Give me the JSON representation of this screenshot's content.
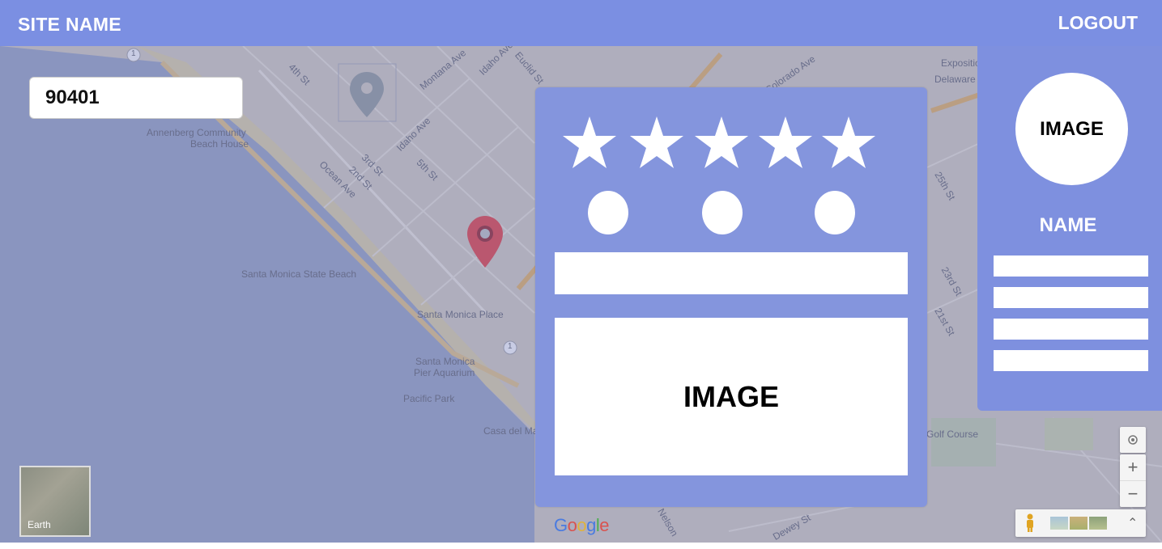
{
  "header": {
    "site_name": "SITE NAME",
    "logout_label": "LOGOUT"
  },
  "search": {
    "zip_value": "90401"
  },
  "map": {
    "labels": [
      "4th St",
      "Montana Ave",
      "Idaho Ave",
      "Euclid St",
      "Idaho Ave",
      "5th St",
      "3rd St",
      "2nd St",
      "Ocean Ave",
      "Annenberg Community",
      "Beach House",
      "Santa Monica State Beach",
      "Santa Monica Place",
      "Santa Monica",
      "Pier Aquarium",
      "Pacific Park",
      "Casa del Mar",
      "Colorado Ave",
      "Expositio",
      "Delaware Ave",
      "25th St",
      "23rd St",
      "21st St",
      "Golf Course",
      "Dewey St",
      "Nelson"
    ],
    "route_badge": "1",
    "earth_label": "Earth",
    "attribution": [
      "G",
      "o",
      "o",
      "g",
      "l",
      "e"
    ]
  },
  "review_card": {
    "rating_max": 5,
    "rating_value": 5,
    "option_count": 3,
    "image_label": "IMAGE"
  },
  "profile": {
    "avatar_label": "IMAGE",
    "name": "NAME",
    "field_count": 4
  },
  "controls": {
    "zoom_in": "+",
    "zoom_out": "−",
    "expand": "⌃"
  },
  "colors": {
    "header_bg": "#7b8fe2",
    "card_bg": "#8495dd",
    "pin_red": "#d93b3b"
  }
}
